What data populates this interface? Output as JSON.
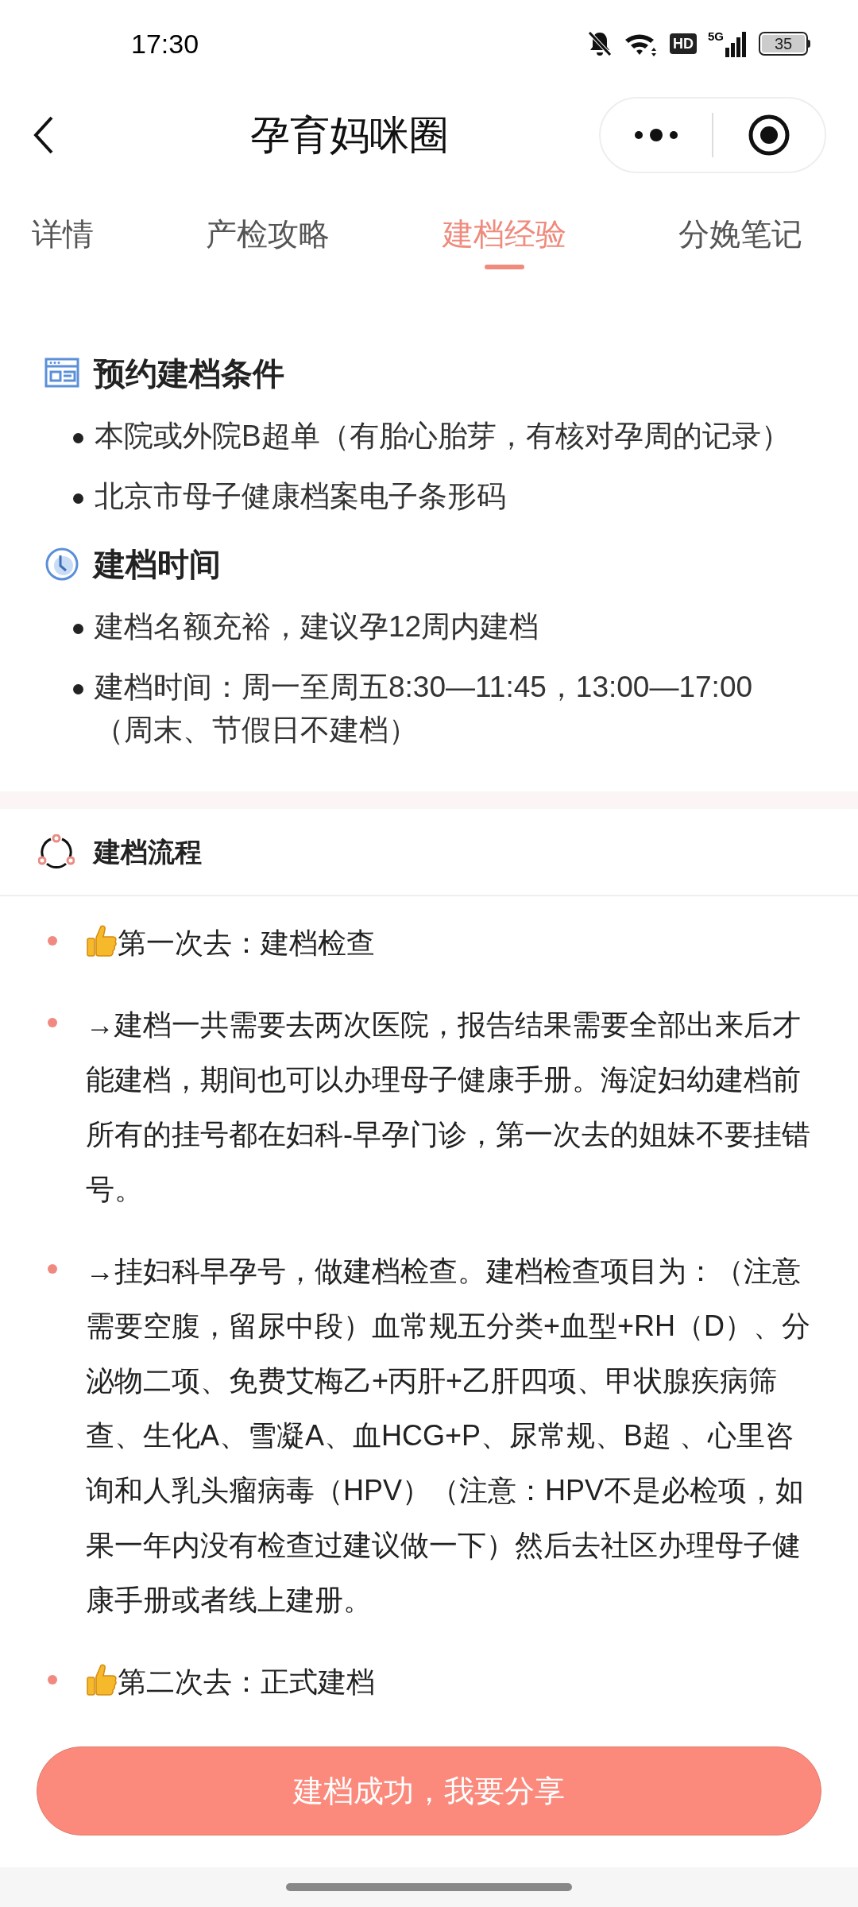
{
  "status_bar": {
    "time": "17:30",
    "battery": "35",
    "network": "5G",
    "hd": "HD"
  },
  "header": {
    "title": "孕育妈咪圈"
  },
  "tabs": [
    {
      "label": "详情",
      "selected": false
    },
    {
      "label": "产检攻略",
      "selected": false
    },
    {
      "label": "建档经验",
      "selected": true
    },
    {
      "label": "分娩笔记",
      "selected": false
    }
  ],
  "sections": [
    {
      "kind": "calendar",
      "title": "预约建档条件",
      "items": [
        "本院或外院B超单（有胎心胎芽，有核对孕周的记录）",
        "北京市母子健康档案电子条形码"
      ]
    },
    {
      "kind": "clock",
      "title": "建档时间",
      "items": [
        "建档名额充裕，建议孕12周内建档",
        "建档时间：周一至周五8:30—11:45，13:00—17:00（周末、节假日不建档）"
      ]
    }
  ],
  "flow": {
    "title": "建档流程",
    "items": [
      {
        "kind": "step",
        "text": "第一次去：建档检查"
      },
      {
        "kind": "note",
        "text": "→建档一共需要去两次医院，报告结果需要全部出来后才能建档，期间也可以办理母子健康手册。海淀妇幼建档前所有的挂号都在妇科-早孕门诊，第一次去的姐妹不要挂错号。"
      },
      {
        "kind": "note",
        "text": "→挂妇科早孕号，做建档检查。建档检查项目为：（注意需要空腹，留尿中段）血常规五分类+血型+RH（D）、分泌物二项、免费艾梅乙+丙肝+乙肝四项、甲状腺疾病筛查、生化A、雪凝A、血HCG+P、尿常规、B超 、心里咨询和人乳头瘤病毒（HPV）（注意：HPV不是必检项，如果一年内没有检查过建议做一下）然后去社区办理母子健康手册或者线上建册。"
      },
      {
        "kind": "step",
        "text": "第二次去：正式建档"
      }
    ]
  },
  "action_button": "建档成功，我要分享"
}
